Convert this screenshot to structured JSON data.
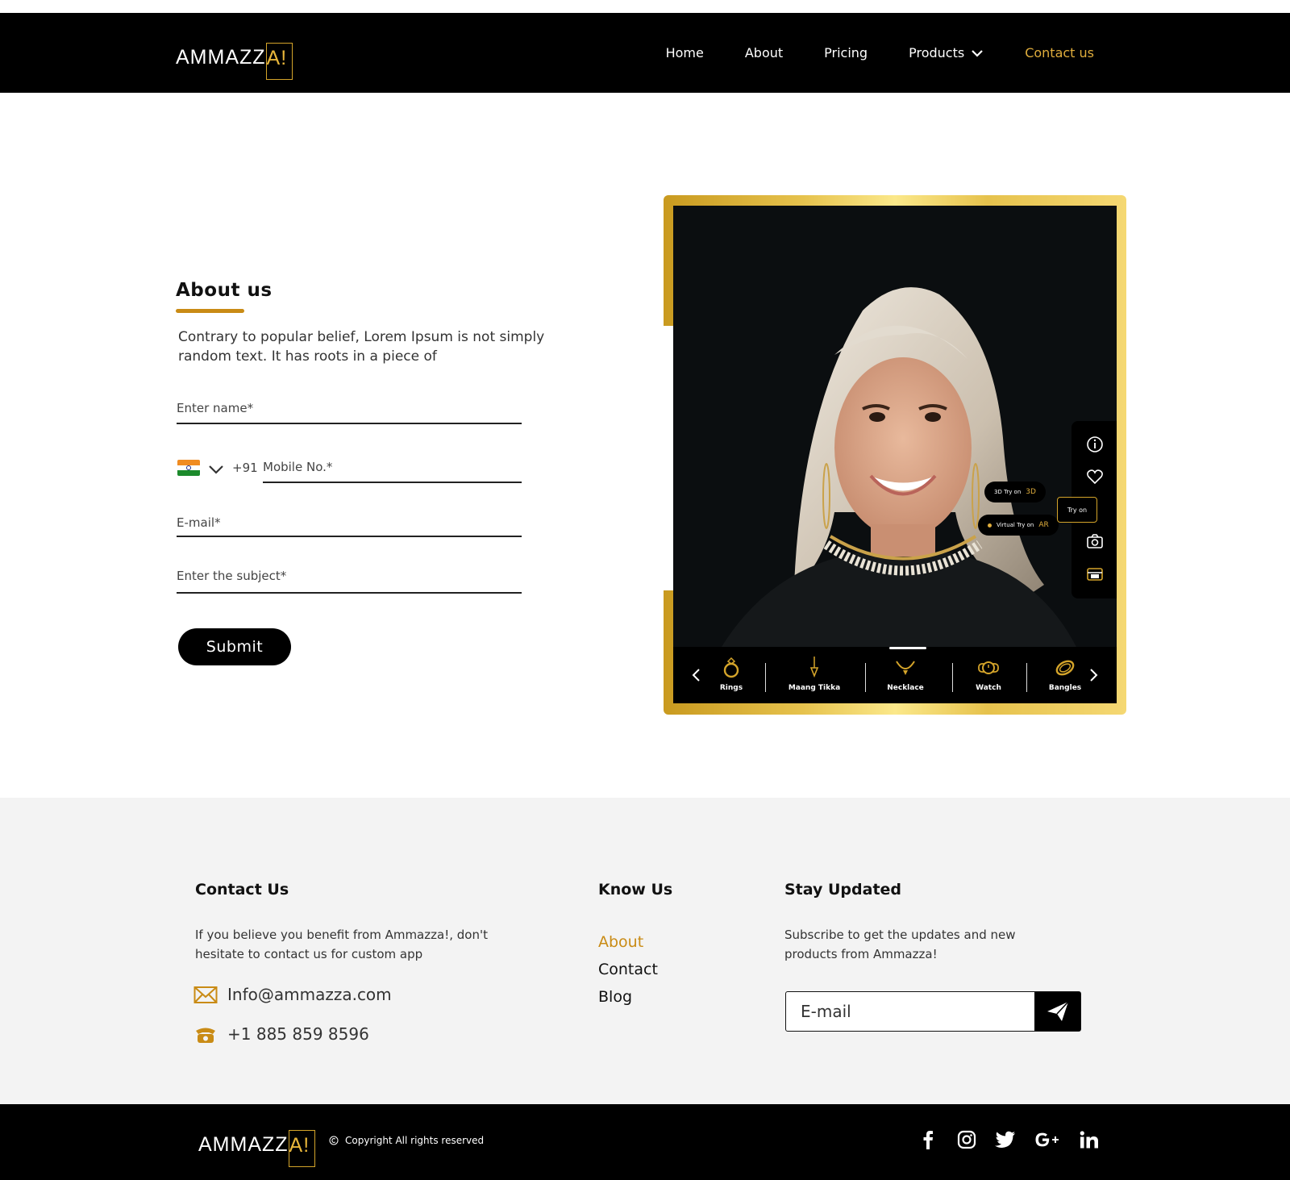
{
  "brand": {
    "logo_word": "AMMAZZ",
    "logo_box": "A!"
  },
  "nav": {
    "home": "Home",
    "about": "About",
    "pricing": "Pricing",
    "products": "Products",
    "contact": "Contact us"
  },
  "about": {
    "title": "About us",
    "text": "Contrary to popular belief, Lorem Ipsum is not simply random text. It has roots in a piece of"
  },
  "form": {
    "name_placeholder": "Enter name*",
    "dial_code": "+91",
    "mobile_placeholder": "Mobile No.*",
    "email_placeholder": "E-mail*",
    "subject_placeholder": "Enter the subject*",
    "submit_label": "Submit"
  },
  "preview": {
    "tryon_label": "Try on",
    "pill_3d_label": "3D Try on",
    "pill_3d_tag": "3D",
    "pill_ar_label": "Virtual Try on",
    "pill_ar_tag": "AR",
    "categories": [
      "Rings",
      "Maang Tikka",
      "Necklace",
      "Watch",
      "Bangles"
    ]
  },
  "footer": {
    "contact_title": "Contact Us",
    "contact_text": "If you believe you benefit from Ammazza!, don't hesitate to contact us for custom app",
    "email": "Info@ammazza.com",
    "phone": "+1 885 859 8596",
    "know_title": "Know Us",
    "know_links": [
      "About",
      "Contact",
      "Blog"
    ],
    "stay_title": "Stay Updated",
    "stay_text": "Subscribe to get the updates and new products from Ammazza!",
    "subscribe_placeholder": "E-mail",
    "copyright": "Copyright All rights reserved"
  },
  "colors": {
    "gold": "#c98b15",
    "accent": "#e0ad3c",
    "dark": "#000000",
    "footer_bg": "#f3f3f3"
  }
}
